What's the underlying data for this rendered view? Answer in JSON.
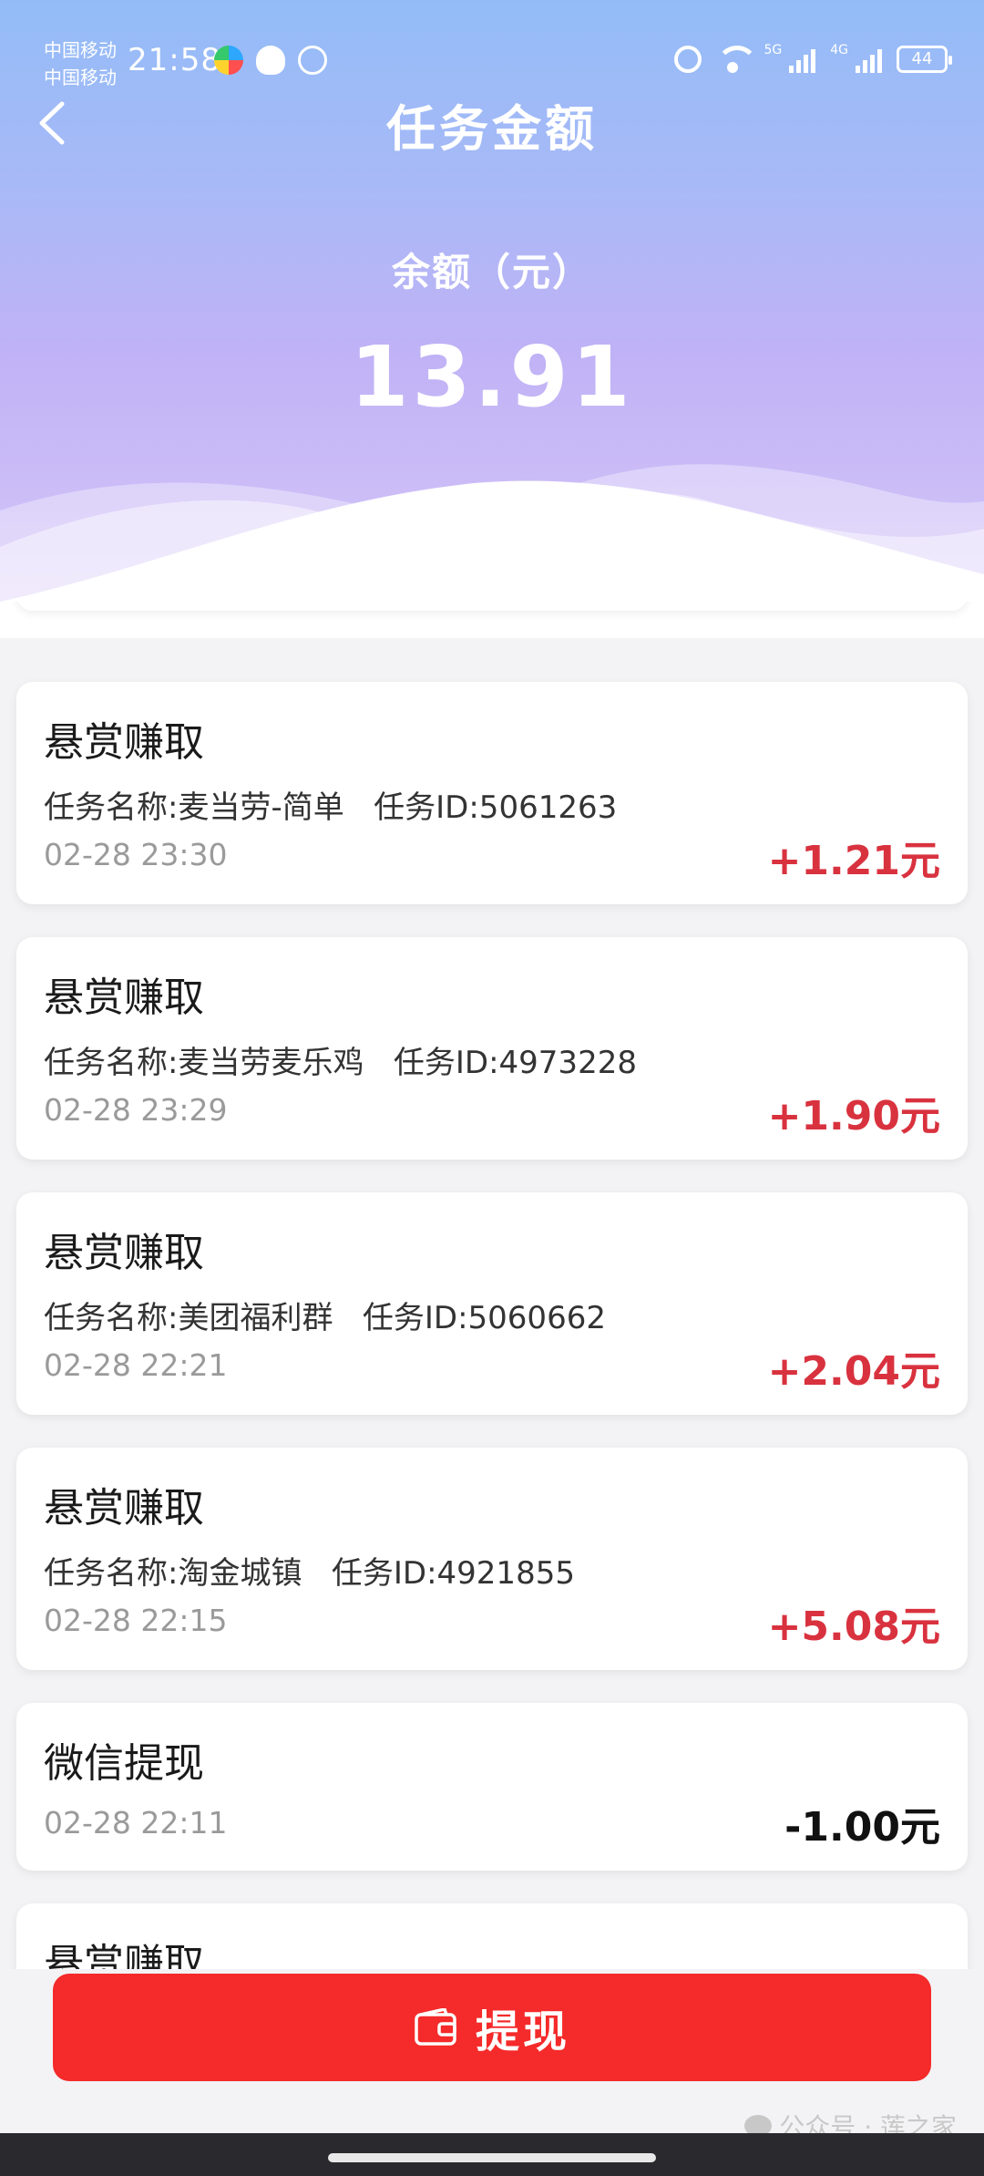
{
  "status_bar": {
    "carrier_1": "中国移动",
    "carrier_2": "中国移动",
    "time": "21:58",
    "net_1": "5G",
    "net_2": "4G",
    "battery": "44"
  },
  "header": {
    "title": "任务金额",
    "balance_label": "余额（元）",
    "balance_value": "13.91"
  },
  "records": [
    {
      "type": "悬赏赚取",
      "desc": "任务名称:麦当劳-简单   任务ID:5061263",
      "time": "02-28 23:30",
      "amount": "+1.21元"
    },
    {
      "type": "悬赏赚取",
      "desc": "任务名称:麦当劳麦乐鸡   任务ID:4973228",
      "time": "02-28 23:29",
      "amount": "+1.90元"
    },
    {
      "type": "悬赏赚取",
      "desc": "任务名称:美团福利群   任务ID:5060662",
      "time": "02-28 22:21",
      "amount": "+2.04元"
    },
    {
      "type": "悬赏赚取",
      "desc": "任务名称:淘金城镇   任务ID:4921855",
      "time": "02-28 22:15",
      "amount": "+5.08元"
    },
    {
      "type": "微信提现",
      "time": "02-28 22:11",
      "amount": "-1.00元"
    },
    {
      "type": "悬赏赚取"
    }
  ],
  "withdraw_button": "提现",
  "watermark": "公众号 · 莲之家",
  "colors": {
    "positive_amount": "#d9323f",
    "negative_amount": "#111111",
    "withdraw_button": "#f52a2a"
  }
}
